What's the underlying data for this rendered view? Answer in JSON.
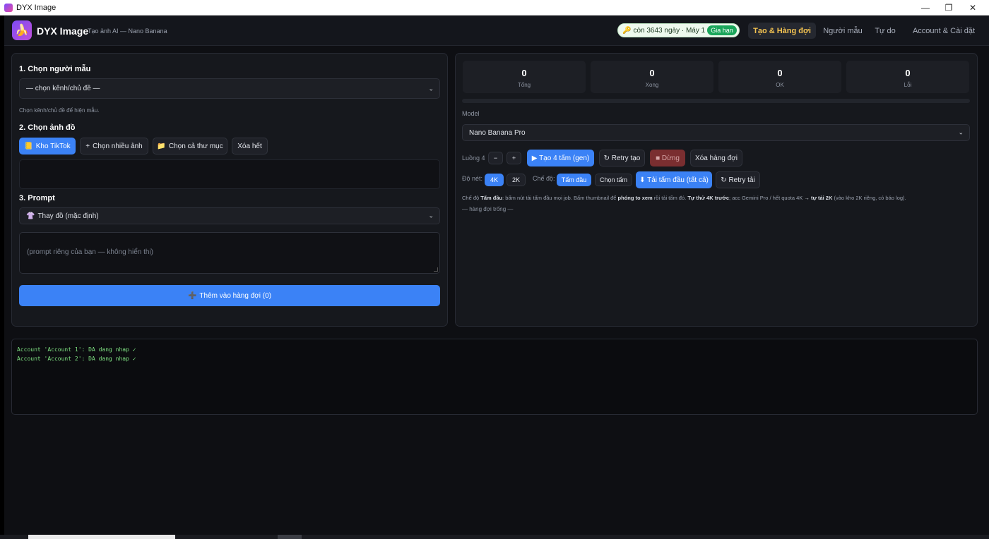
{
  "window": {
    "title": "DYX Image",
    "minimize": "—",
    "restore": "❐",
    "close": "✕"
  },
  "header": {
    "logo_glyph": "🍌",
    "brand": "DYX Image",
    "subtitle": "Tạo ảnh AI — Nano Banana",
    "license_icon": "🔑",
    "license_text": "còn 3643 ngày · Máy 1",
    "license_badge": "Gia hạn",
    "tabs": [
      {
        "label": "Tạo & Hàng đợi",
        "active": true
      },
      {
        "label": "Người mẫu",
        "active": false
      },
      {
        "label": "Tự do",
        "active": false
      },
      {
        "label": "Account & Cài đặt",
        "active": false
      }
    ]
  },
  "left": {
    "section1_title": "1. Chọn người mẫu",
    "model_select": "— chọn kênh/chủ đề —",
    "model_hint": "Chọn kênh/chủ đề để hiện mẫu.",
    "section2_title": "2. Chọn ảnh đồ",
    "btn_kho_tiktok": "Kho TikTok",
    "btn_kho_icon": "📒",
    "btn_chon_nhieu": "Chọn nhiều ảnh",
    "btn_chon_nhieu_icon": "+",
    "btn_chon_thu_muc": "Chọn cả thư mục",
    "btn_folder_icon": "📁",
    "btn_xoa_het": "Xóa hết",
    "section3_title": "3. Prompt",
    "prompt_icon": "👚",
    "prompt_select": "Thay đồ (mặc định)",
    "prompt_placeholder": "(prompt riêng của bạn — không hiển thị)",
    "add_icon": "➕",
    "add_button": "Thêm vào hàng đợi (0)"
  },
  "right": {
    "stats": [
      {
        "value": "0",
        "label": "Tổng"
      },
      {
        "value": "0",
        "label": "Xong"
      },
      {
        "value": "0",
        "label": "OK"
      },
      {
        "value": "0",
        "label": "Lỗi"
      }
    ],
    "progress": 0,
    "model_label": "Model",
    "model_select": "Nano Banana Pro",
    "luong_label": "Luồng 4",
    "minus": "−",
    "plus": "+",
    "btn_tao": "▶ Tạo 4 tấm (gen)",
    "btn_retry_tao": "↻ Retry tạo",
    "btn_dung": "■ Dừng",
    "btn_xoa_hang_doi": "Xóa hàng đợi",
    "do_net_label": "Độ nét:",
    "res_4k": "4K",
    "res_2k": "2K",
    "che_do_label": "Chế độ:",
    "mode_tam_dau": "Tấm đầu",
    "mode_chon_tam": "Chọn tấm",
    "btn_tai_tam_dau": "⬇ Tải tấm đầu (tất cả)",
    "btn_retry_tai": "↻ Retry tải",
    "note": {
      "p1": "Chế độ ",
      "b1": "Tấm đầu",
      "p2": ": bấm nút tải tấm đầu mọi job. Bấm thumbnail để ",
      "b2": "phóng to xem",
      "p3": " rồi tải tấm đó. ",
      "b3": "Tự thử 4K trước",
      "p4": "; acc Gemini Pro / hết quota 4K ",
      "b4": "→ tự tải 2K",
      "p5": " (vào kho 2K riêng, có báo log)."
    },
    "queue_empty": "— hàng đợi trống —"
  },
  "log": {
    "lines": [
      "Account 'Account 1': DA dang nhap ✓",
      "Account 'Account 2': DA dang nhap ✓"
    ]
  }
}
